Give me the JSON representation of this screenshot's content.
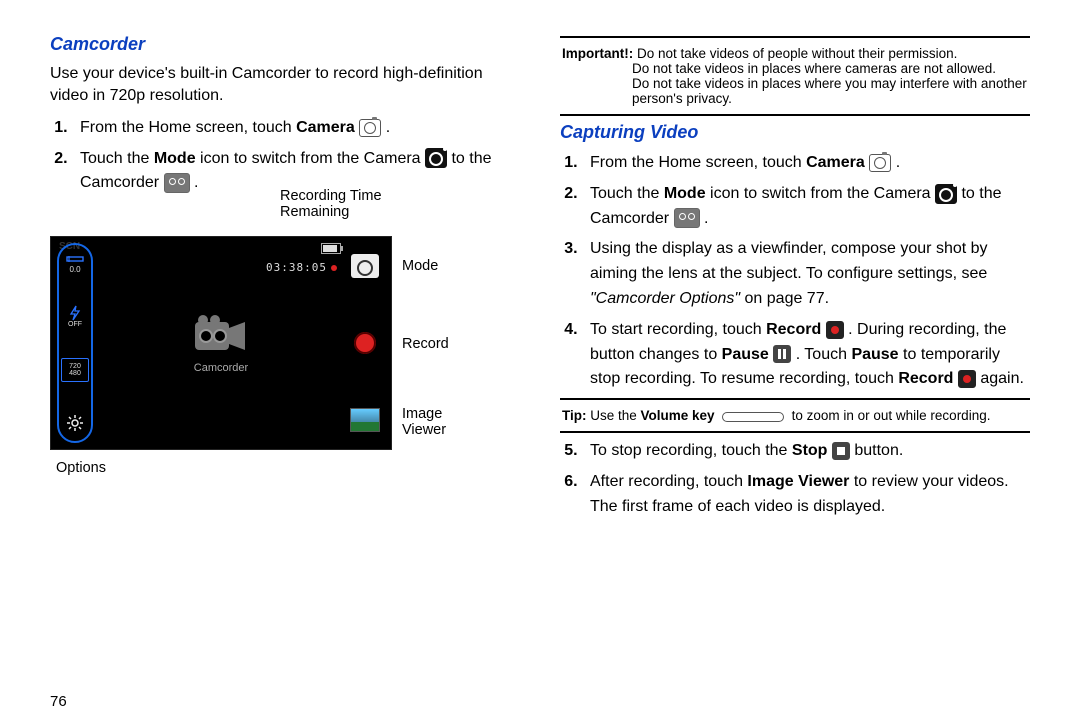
{
  "left": {
    "section_title": "Camcorder",
    "intro": "Use your device's built-in Camcorder to record high-definition video in 720p resolution.",
    "step1_pre": "From the Home screen, touch ",
    "step1_bold": "Camera",
    "period": " .",
    "step2_pre": "Touch the ",
    "step2_b1": "Mode",
    "step2_mid": " icon to switch from the Camera ",
    "step2_post": " to the Camcorder ",
    "shot": {
      "callout_time": "Recording Time Remaining",
      "callout_mode": "Mode",
      "callout_record": "Record",
      "callout_viewer": "Image Viewer",
      "callout_options": "Options",
      "timer": "03:38:05",
      "center_label": "Camcorder",
      "left_ev": "0.0",
      "left_off": "OFF",
      "left_res1": "720",
      "left_res2": "480",
      "scn": "SCN"
    }
  },
  "right": {
    "important": {
      "hdr": "Important!:",
      "l1": " Do not take videos of people without their permission.",
      "l2": "Do not take videos in places where cameras are not allowed.",
      "l3": "Do not take videos in places where you may interfere with another person's privacy."
    },
    "section_title": "Capturing Video",
    "s1_pre": "From the Home screen, touch ",
    "s1_bold": "Camera",
    "s2_pre": "Touch the ",
    "s2_b1": "Mode",
    "s2_mid": " icon to switch from the Camera ",
    "s2_post": " to the Camcorder ",
    "s3_a": "Using the display as a viewfinder, compose your shot by aiming the lens at the subject. To configure settings, see ",
    "s3_it": "\"Camcorder Options\"",
    "s3_b": " on page 77.",
    "s4_a": "To start recording, touch ",
    "s4_rec": "Record",
    "s4_b": " . During recording, the button changes to ",
    "s4_pause": "Pause",
    "s4_c": " . Touch ",
    "s4_pause2": "Pause",
    "s4_d": " to temporarily stop recording. To resume recording, touch ",
    "s4_rec2": "Record",
    "s4_e": " again.",
    "tip_hdr": "Tip:",
    "tip_a": " Use the ",
    "tip_vol": "Volume key",
    "tip_b": " to zoom in or out while recording.",
    "s5_a": "To stop recording, touch the ",
    "s5_stop": "Stop",
    "s5_b": " button.",
    "s6_a": "After recording, touch ",
    "s6_iv": "Image Viewer",
    "s6_b": " to review your videos. The first frame of each video is displayed."
  },
  "page_number": "76"
}
